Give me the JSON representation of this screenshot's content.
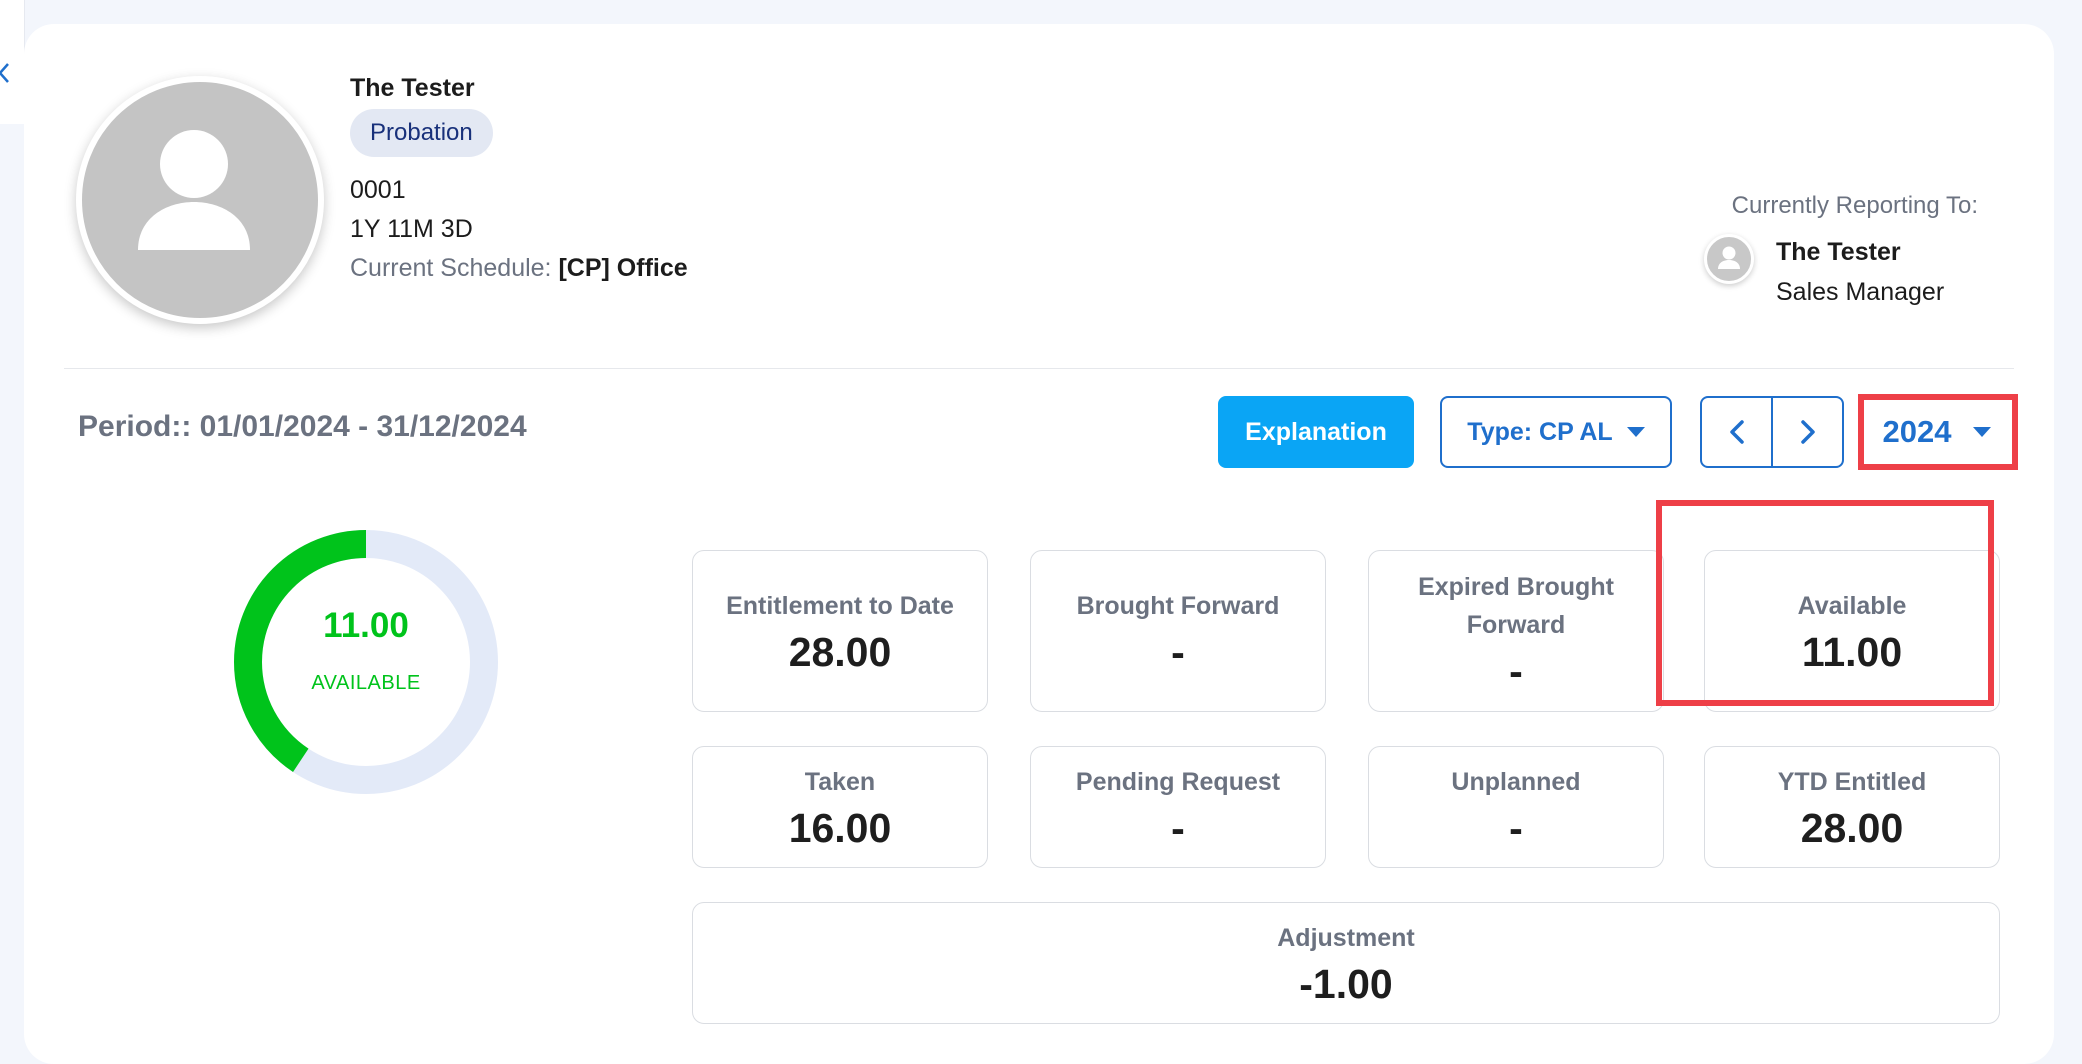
{
  "profile": {
    "name": "The Tester",
    "status": "Probation",
    "employee_id": "0001",
    "tenure": "1Y 11M 3D",
    "schedule_label": "Current Schedule:",
    "schedule_value": "[CP] Office"
  },
  "reporting": {
    "label": "Currently Reporting To:",
    "manager_name": "The Tester",
    "manager_title": "Sales Manager"
  },
  "period": "Period:: 01/01/2024 - 31/12/2024",
  "toolbar": {
    "explanation_label": "Explanation",
    "type_label": "Type: CP AL",
    "year": "2024"
  },
  "donut": {
    "value": "11.00",
    "label": "AVAILABLE",
    "available_fraction": 0.407,
    "colors": {
      "available": "#00c31b",
      "track": "#e3eaf8"
    }
  },
  "stats": {
    "entitlement_to_date": {
      "title": "Entitlement to Date",
      "value": "28.00"
    },
    "brought_forward": {
      "title": "Brought Forward",
      "value": "-"
    },
    "expired_brought_forward": {
      "title": "Expired Brought Forward",
      "value": "-"
    },
    "available": {
      "title": "Available",
      "value": "11.00"
    },
    "taken": {
      "title": "Taken",
      "value": "16.00"
    },
    "pending_request": {
      "title": "Pending Request",
      "value": "-"
    },
    "unplanned": {
      "title": "Unplanned",
      "value": "-"
    },
    "ytd_entitled": {
      "title": "YTD Entitled",
      "value": "28.00"
    },
    "adjustment": {
      "title": "Adjustment",
      "value": "-1.00"
    }
  },
  "colors": {
    "accent": "#1f6fcc",
    "primary_button": "#0aa5f5",
    "highlight": "#ee3f47"
  }
}
